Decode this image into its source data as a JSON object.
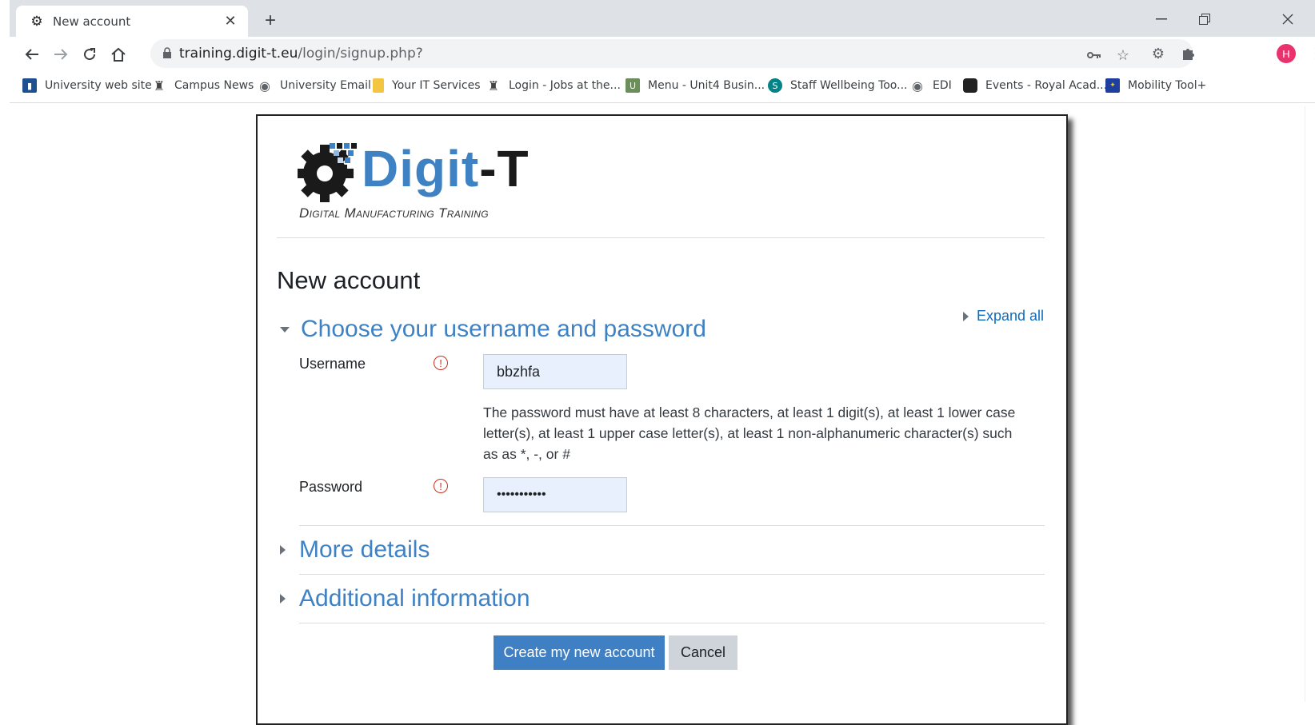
{
  "browser": {
    "tab_title": "New account",
    "tab_close": "✕",
    "new_tab": "+",
    "url_host": "training.digit-t.eu",
    "url_path": "/login/signup.php?",
    "profile_initial": "H"
  },
  "bookmarks": [
    {
      "label": "University web site",
      "icon": "university-icon",
      "color": "#1d4f91"
    },
    {
      "label": "Campus News",
      "icon": "rook-icon",
      "color": "#444444"
    },
    {
      "label": "University Email",
      "icon": "globe-icon",
      "color": "#5f6368"
    },
    {
      "label": "Your IT Services",
      "icon": "folder-icon",
      "color": "#f4c542"
    },
    {
      "label": "Login - Jobs at the...",
      "icon": "rook-icon",
      "color": "#444444"
    },
    {
      "label": "Menu - Unit4 Busin...",
      "icon": "unit4-icon",
      "color": "#6b8e5a"
    },
    {
      "label": "Staff Wellbeing Too...",
      "icon": "sharepoint-icon",
      "color": "#038387"
    },
    {
      "label": "EDI",
      "icon": "globe-icon",
      "color": "#5f6368"
    },
    {
      "label": "Events - Royal Acad...",
      "icon": "royal-academy-icon",
      "color": "#222222"
    },
    {
      "label": "Mobility Tool+",
      "icon": "eu-flag-icon",
      "color": "#1f3f9f"
    }
  ],
  "logo": {
    "word_blue": "Digit",
    "word_dark": "-T",
    "subtitle": "Digital Manufacturing Training"
  },
  "page": {
    "title": "New account",
    "expand_all": "Expand all"
  },
  "sections": {
    "credentials": {
      "title": "Choose your username and password",
      "username_label": "Username",
      "username_value": "bbzhfa",
      "password_hint": "The password must have at least 8 characters, at least 1 digit(s), at least 1 lower case letter(s), at least 1 upper case letter(s), at least 1 non-alphanumeric character(s) such as as *, -, or #",
      "password_label": "Password",
      "password_value": "•••••••••••",
      "required_glyph": "!"
    },
    "more_details": {
      "title": "More details"
    },
    "additional": {
      "title": "Additional information"
    }
  },
  "actions": {
    "create": "Create my new account",
    "cancel": "Cancel"
  },
  "colors": {
    "brand_blue": "#3f82c4",
    "link": "#0f6cbf",
    "required": "#ca3120"
  }
}
